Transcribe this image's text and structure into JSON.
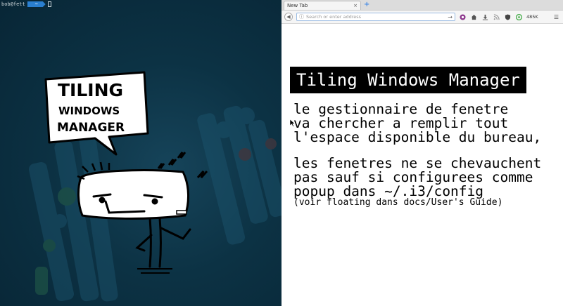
{
  "terminal": {
    "prompt_user": "bob@fett",
    "prompt_arrow": "~"
  },
  "cartoon": {
    "line1": "TILING",
    "line2": "WINDOWS",
    "line3": "MANAGER"
  },
  "browser": {
    "tab_title": "New Tab",
    "tab_close": "×",
    "tab_add": "+",
    "url_placeholder": "Search or enter address",
    "counter_badge": "485K",
    "colors": {
      "tab_add": "#1a73e8",
      "url_border": "#9bbce3",
      "prompt_arrow_bg": "#2a7fd0"
    },
    "icons": [
      "back-icon",
      "info-icon",
      "reload-icon",
      "pocket-icon",
      "home-icon",
      "download-icon",
      "rss-icon",
      "shield-icon",
      "addon-icon",
      "menu-icon"
    ]
  },
  "slide": {
    "title": "Tiling Windows Manager",
    "para1": [
      "le gestionnaire de fenetre",
      "va chercher a remplir tout",
      "l'espace disponible du bureau,"
    ],
    "para2": [
      "les fenetres ne se chevauchent",
      "pas sauf si configurees comme",
      "popup dans ~/.i3/config"
    ],
    "note": "(voir floating dans docs/User's Guide)"
  }
}
